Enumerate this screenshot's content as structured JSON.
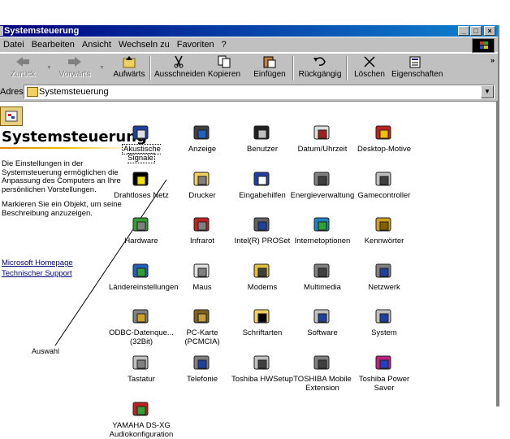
{
  "window": {
    "title": "Systemsteuerung"
  },
  "menu": [
    "Datei",
    "Bearbeiten",
    "Ansicht",
    "Wechseln zu",
    "Favoriten",
    "?"
  ],
  "toolbar": [
    {
      "label": "Zurück",
      "icon": "back-arrow-icon",
      "disabled": true
    },
    {
      "label": "Vorwärts",
      "icon": "forward-arrow-icon",
      "disabled": true
    },
    {
      "label": "Aufwärts",
      "icon": "up-folder-icon",
      "disabled": false
    },
    {
      "label": "Ausschneiden",
      "icon": "scissors-icon",
      "disabled": false
    },
    {
      "label": "Kopieren",
      "icon": "copy-icon",
      "disabled": false
    },
    {
      "label": "Einfügen",
      "icon": "paste-icon",
      "disabled": false
    },
    {
      "label": "Rückgängig",
      "icon": "undo-icon",
      "disabled": false
    },
    {
      "label": "Löschen",
      "icon": "delete-icon",
      "disabled": false
    },
    {
      "label": "Eigenschaften",
      "icon": "properties-icon",
      "disabled": false
    }
  ],
  "address": {
    "label": "Adresse",
    "value": "Systemsteuerung"
  },
  "left_panel": {
    "title": "Systemsteuerung",
    "description": "Die Einstellungen in der Systemsteuerung ermöglichen die Anpassung des Computers an Ihre persönlichen Vorstellungen.",
    "hint": "Markieren Sie ein Objekt, um seine Beschreibung anzuzeigen.",
    "links": [
      "Microsoft Homepage",
      "Technischer Support"
    ]
  },
  "annotation": "Auswahl",
  "items": [
    {
      "label": "Akustische Signale",
      "icon": "speaker-icon",
      "selected": true
    },
    {
      "label": "Anzeige",
      "icon": "display-icon"
    },
    {
      "label": "Benutzer",
      "icon": "users-icon"
    },
    {
      "label": "Datum/Uhrzeit",
      "icon": "calendar-clock-icon"
    },
    {
      "label": "Desktop-Motive",
      "icon": "desktop-themes-icon"
    },
    {
      "label": "Drahtloses Netz",
      "icon": "wireless-icon"
    },
    {
      "label": "Drucker",
      "icon": "printer-folder-icon"
    },
    {
      "label": "Eingabehilfen",
      "icon": "accessibility-icon"
    },
    {
      "label": "Energieverwaltung",
      "icon": "power-plug-icon"
    },
    {
      "label": "Gamecontroller",
      "icon": "joystick-icon"
    },
    {
      "label": "Hardware",
      "icon": "hardware-icon"
    },
    {
      "label": "Infrarot",
      "icon": "infrared-icon"
    },
    {
      "label": "Intel(R) PROSet",
      "icon": "intel-proset-icon"
    },
    {
      "label": "Internetoptionen",
      "icon": "internet-globe-icon"
    },
    {
      "label": "Kennwörter",
      "icon": "keys-icon"
    },
    {
      "label": "Ländereinstellungen",
      "icon": "globe-icon"
    },
    {
      "label": "Maus",
      "icon": "mouse-icon"
    },
    {
      "label": "Modems",
      "icon": "modem-icon"
    },
    {
      "label": "Multimedia",
      "icon": "multimedia-icon"
    },
    {
      "label": "Netzwerk",
      "icon": "network-icon"
    },
    {
      "label": "ODBC-Datenque... (32Bit)",
      "icon": "odbc-icon"
    },
    {
      "label": "PC-Karte (PCMCIA)",
      "icon": "pc-card-icon"
    },
    {
      "label": "Schriftarten",
      "icon": "fonts-folder-icon"
    },
    {
      "label": "Software",
      "icon": "software-icon"
    },
    {
      "label": "System",
      "icon": "system-computer-icon"
    },
    {
      "label": "Tastatur",
      "icon": "keyboard-icon"
    },
    {
      "label": "Telefonie",
      "icon": "telephony-icon"
    },
    {
      "label": "Toshiba HWSetup",
      "icon": "toshiba-hwsetup-icon"
    },
    {
      "label": "TOSHIBA Mobile Extension",
      "icon": "toshiba-mobile-icon"
    },
    {
      "label": "Toshiba Power Saver",
      "icon": "toshiba-power-icon"
    },
    {
      "label": "YAMAHA DS-XG Audiokonfiguration",
      "icon": "yamaha-audio-icon"
    }
  ]
}
